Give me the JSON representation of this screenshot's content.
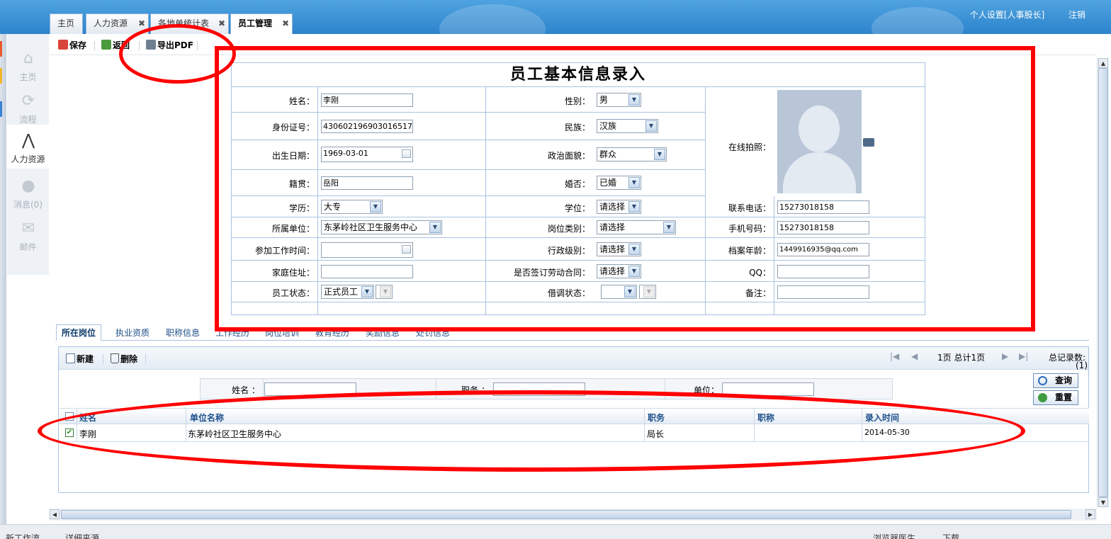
{
  "tabs": [
    {
      "label": "主页",
      "closable": false
    },
    {
      "label": "人力资源",
      "closable": true
    },
    {
      "label": "各地单统计表",
      "closable": true
    },
    {
      "label": "员工管理",
      "closable": true,
      "active": true
    }
  ],
  "header": {
    "personal_settings": "个人设置[人事股长]",
    "logout": "注销"
  },
  "sidebar": {
    "items": [
      {
        "label": "主页",
        "icon": "home-icon"
      },
      {
        "label": "流程",
        "icon": "refresh-icon"
      },
      {
        "label": "人力资源",
        "icon": "people-icon",
        "active": true
      },
      {
        "label": "消息(0)",
        "icon": "message-icon"
      },
      {
        "label": "邮件",
        "icon": "mail-icon"
      }
    ]
  },
  "toolbar": {
    "save": "保存",
    "back": "返回",
    "export_pdf": "导出PDF"
  },
  "form": {
    "title": "员工基本信息录入",
    "name_label": "姓名：",
    "name": "李刚",
    "gender_label": "性别：",
    "gender": "男",
    "id_label": "身份证号：",
    "id_number": "430602196903016517",
    "ethnicity_label": "民族：",
    "ethnicity": "汉族",
    "birth_label": "出生日期：",
    "birth_date": "1969-03-01",
    "politics_label": "政治面貌：",
    "politics": "群众",
    "native_label": "籍贯：",
    "native_place": "岳阳",
    "marriage_label": "婚否：",
    "marriage": "已婚",
    "photo_label": "在线拍照：",
    "education_label": "学历：",
    "education": "大专",
    "degree_label": "学位：",
    "degree": "请选择",
    "phone_label": "联系电话：",
    "phone": "15273018158",
    "unit_label": "所属单位：",
    "unit": "东茅岭社区卫生服务中心",
    "post_type_label": "岗位类别：",
    "post_type": "请选择",
    "mobile_label": "手机号码：",
    "mobile": "15273018158",
    "work_start_label": "参加工作时间：",
    "work_start": "",
    "admin_level_label": "行政级别：",
    "admin_level": "请选择",
    "archive_age_label": "档案年龄：",
    "archive_age": "1449916935@qq.com",
    "address_label": "家庭住址：",
    "address": "",
    "contract_label": "是否签订劳动合同：",
    "contract": "请选择",
    "qq_label": "QQ：",
    "qq": "",
    "status_label": "员工状态：",
    "status": "正式员工",
    "status2": "",
    "loan_label": "借调状态：",
    "loan": "",
    "loan2": "",
    "remark_label": "备注：",
    "remark": ""
  },
  "subtabs": [
    "所在岗位",
    "执业资质",
    "职称信息",
    "工作经历",
    "岗位培训",
    "教育经历",
    "奖励信息",
    "处罚信息"
  ],
  "panel": {
    "new": "新建",
    "delete": "删除",
    "page_info": "1页 总计1页",
    "total_label": "总记录数:",
    "total_value": "(1)",
    "search_name_label": "姓名 ：",
    "search_position_label": "职务 ：",
    "search_unit_label": "单位：",
    "query": "查询",
    "reset": "重置"
  },
  "grid": {
    "columns": [
      "姓名",
      "单位名称",
      "职务",
      "职称",
      "录入时间"
    ],
    "rows": [
      {
        "checked": true,
        "cells": [
          "李刚",
          "东茅岭社区卫生服务中心",
          "局长",
          "",
          "2014-05-30"
        ]
      }
    ]
  },
  "colors": {
    "header_blue": "#2d84cc",
    "annotation_red": "#ff0000",
    "border_blue": "#a9c3e2"
  },
  "statusbar": {
    "left": "新工作流",
    "middle": "详细来源",
    "right_tool": "浏览器医生",
    "downloads": "下载"
  }
}
